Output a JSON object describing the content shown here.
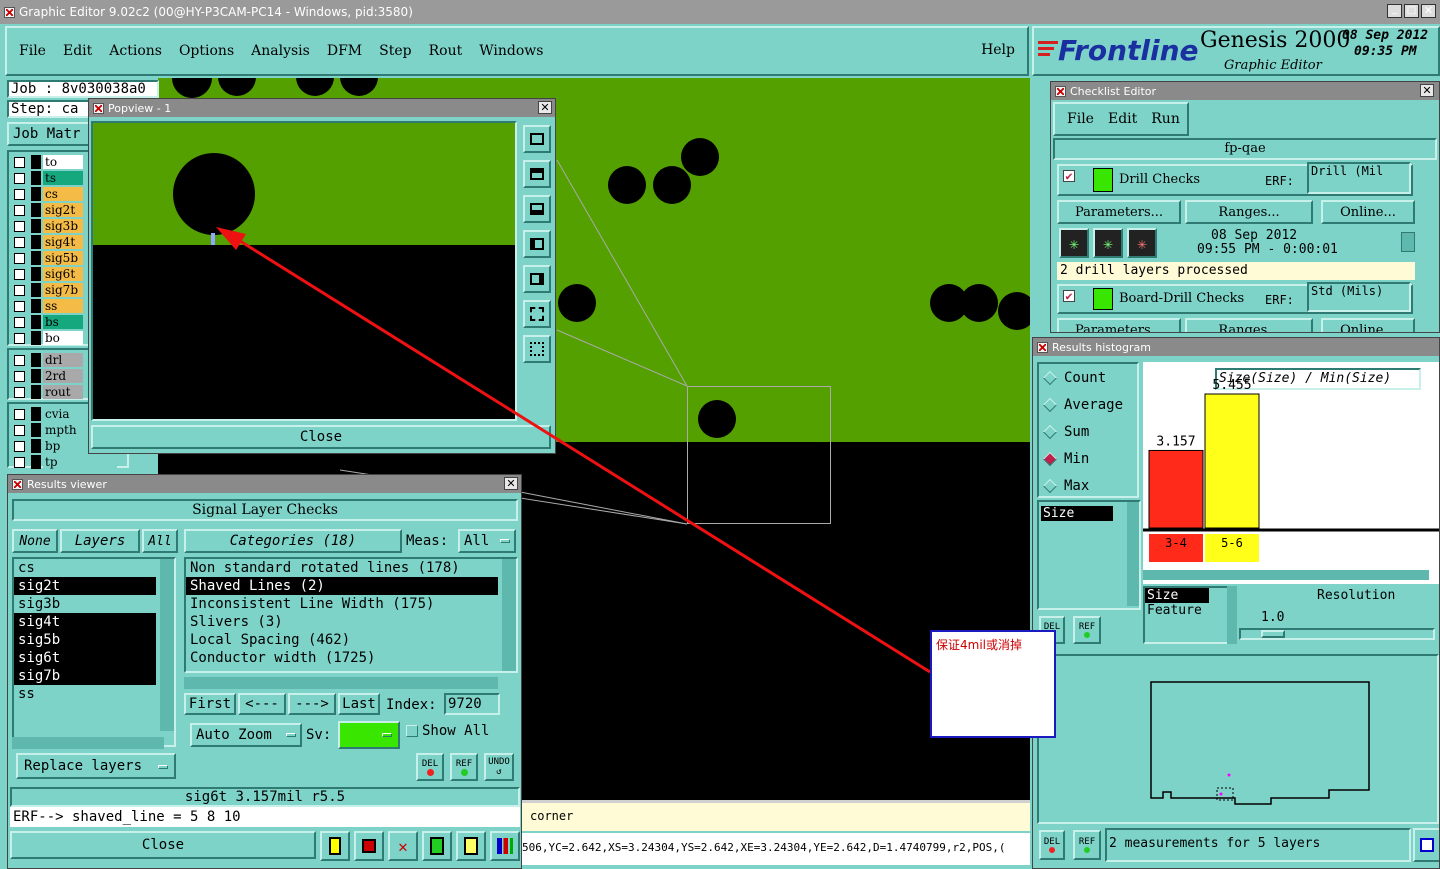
{
  "window": {
    "title": "Graphic Editor 9.02c2 (00@HY-P3CAM-PC14 - Windows, pid:3580)"
  },
  "menu": [
    "File",
    "Edit",
    "Actions",
    "Options",
    "Analysis",
    "DFM",
    "Step",
    "Rout",
    "Windows"
  ],
  "menu_help": "Help",
  "brand": {
    "logo": "Frontline",
    "product": "Genesis 2000",
    "subtitle": "Graphic Editor",
    "date": "08 Sep 2012",
    "time": "09:35 PM"
  },
  "job": {
    "job_label": "Job : 8v030038a0",
    "step_label": "Step: ca",
    "matrix_btn": "Job Matr"
  },
  "layers": [
    {
      "name": "to",
      "color": "#ffffff"
    },
    {
      "name": "ts",
      "color": "#15a87f"
    },
    {
      "name": "cs",
      "color": "#f4bb47"
    },
    {
      "name": "sig2t",
      "color": "#f4bb47"
    },
    {
      "name": "sig3b",
      "color": "#f4bb47"
    },
    {
      "name": "sig4t",
      "color": "#f4bb47"
    },
    {
      "name": "sig5b",
      "color": "#f4bb47"
    },
    {
      "name": "sig6t",
      "color": "#f4bb47"
    },
    {
      "name": "sig7b",
      "color": "#f4bb47"
    },
    {
      "name": "ss",
      "color": "#f4bb47"
    },
    {
      "name": "bs",
      "color": "#15a87f"
    },
    {
      "name": "bo",
      "color": "#ffffff"
    }
  ],
  "drill_layers": [
    "drl",
    "2rd",
    "rout"
  ],
  "other_layers": [
    "cvia",
    "mpth",
    "bp",
    "tp"
  ],
  "popview": {
    "title": "Popview - 1",
    "close": "Close"
  },
  "results_viewer": {
    "title": "Results viewer",
    "heading": "Signal Layer Checks",
    "none_btn": "None",
    "layers_btn": "Layers",
    "all_btn": "All",
    "categories_btn": "Categories (18)",
    "meas_label": "Meas:",
    "meas_value": "All",
    "layers": [
      {
        "name": "cs",
        "sel": false
      },
      {
        "name": "sig2t",
        "sel": true
      },
      {
        "name": "sig3b",
        "sel": false
      },
      {
        "name": "sig4t",
        "sel": true
      },
      {
        "name": "sig5b",
        "sel": true
      },
      {
        "name": "sig6t",
        "sel": true
      },
      {
        "name": "sig7b",
        "sel": true
      },
      {
        "name": "ss",
        "sel": false
      }
    ],
    "categories": [
      {
        "name": "Non standard rotated lines (178)",
        "sel": false
      },
      {
        "name": "Shaved Lines (2)",
        "sel": true
      },
      {
        "name": "Inconsistent Line Width (175)",
        "sel": false
      },
      {
        "name": "Slivers (3)",
        "sel": false
      },
      {
        "name": "Local Spacing (462)",
        "sel": false
      },
      {
        "name": "Conductor width (1725)",
        "sel": false
      }
    ],
    "first": "First",
    "prev": "<---",
    "next": "--->",
    "last": "Last",
    "index_label": "Index:",
    "index_value": "9720",
    "auto_zoom": "Auto Zoom",
    "sv_label": "Sv:",
    "show_all": "Show All",
    "replace_layers": "Replace layers",
    "del": "DEL",
    "ref": "REF",
    "undo": "UNDO",
    "status_line": "sig6t 3.157mil   r5.5",
    "erf_line": "ERF--> shaved_line = 5 8 10",
    "close": "Close"
  },
  "checklist": {
    "title": "Checklist Editor",
    "menu": [
      "File",
      "Edit",
      "Run"
    ],
    "name": "fp-qae",
    "check1": {
      "name": "Drill Checks",
      "erf_label": "ERF:",
      "erf_value": "Drill (Mil",
      "params": "Parameters...",
      "ranges": "Ranges...",
      "online": "Online...",
      "date": "08 Sep 2012",
      "time": "09:55 PM - 0:00:01",
      "status": "2 drill layers processed"
    },
    "check2": {
      "name": "Board-Drill Checks",
      "erf_label": "ERF:",
      "erf_value": "Std (Mils)",
      "params": "Parameters...",
      "ranges": "Ranges...",
      "online": "Online..."
    }
  },
  "histogram": {
    "title": "Results histogram",
    "options": [
      {
        "label": "Count",
        "on": false
      },
      {
        "label": "Average",
        "on": false
      },
      {
        "label": "Sum",
        "on": false
      },
      {
        "label": "Min",
        "on": true
      },
      {
        "label": "Max",
        "on": false
      }
    ],
    "attr_list": [
      "Size"
    ],
    "axis_title": "Size(Size) / Min(Size)",
    "size_label": "Size",
    "feature_label": "Feature",
    "resolution_label": "Resolution",
    "resolution_value": "1.0",
    "del": "DEL",
    "ref": "REF",
    "status": "2 measurements for 5 layers"
  },
  "chart_data": {
    "type": "bar",
    "categories": [
      "3-4",
      "5-6"
    ],
    "values": [
      3.157,
      5.455
    ],
    "colors": [
      "#ff2a1a",
      "#ffff1a"
    ],
    "title": "Size(Size) / Min(Size)"
  },
  "annotation": {
    "note": "保证4mil或消掉"
  },
  "bottom": {
    "corner_text": "corner",
    "coords": "506,YC=2.642,XS=3.24304,YS=2.642,XE=3.24304,YE=2.642,D=1.4740799,r2,POS,("
  }
}
